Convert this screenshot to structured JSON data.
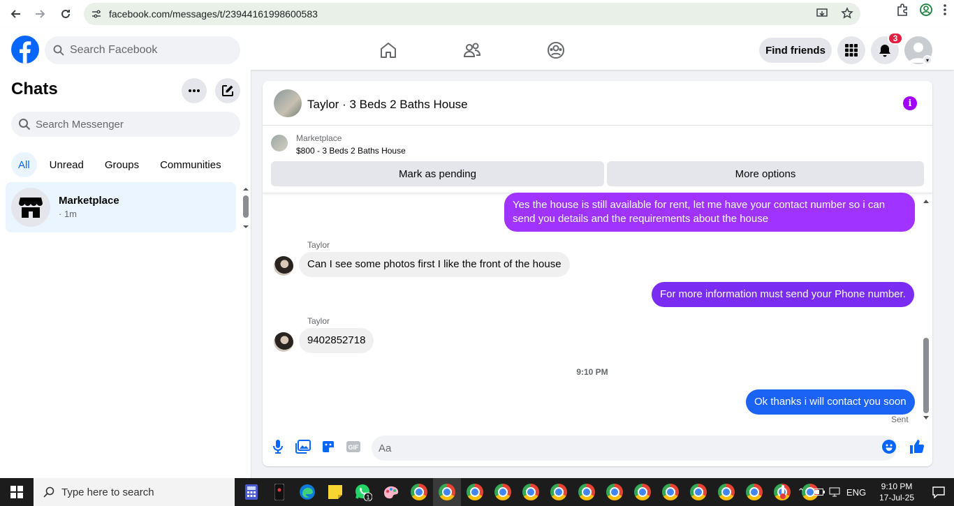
{
  "browser": {
    "url": "facebook.com/messages/t/23944161998600583"
  },
  "header": {
    "search_placeholder": "Search Facebook",
    "find_friends_label": "Find friends",
    "notification_count": "3"
  },
  "sidebar": {
    "title": "Chats",
    "search_placeholder": "Search Messenger",
    "tabs": [
      {
        "label": "All",
        "active": true
      },
      {
        "label": "Unread",
        "active": false
      },
      {
        "label": "Groups",
        "active": false
      },
      {
        "label": "Communities",
        "active": false
      }
    ],
    "chats": [
      {
        "name": "Marketplace",
        "time": "· 1m"
      }
    ]
  },
  "conversation": {
    "title": "Taylor · 3 Beds 2 Baths House",
    "marketplace": {
      "source": "Marketplace",
      "listing": "$800 - 3 Beds 2 Baths House",
      "pending_label": "Mark as pending",
      "options_label": "More options"
    },
    "messages": [
      {
        "direction": "out",
        "text": "Yes the house is still available for rent, let me have your contact number so i can send you details and the requirements about the house"
      },
      {
        "direction": "in",
        "sender": "Taylor",
        "text": "Can I see some photos first I like the front of the house"
      },
      {
        "direction": "out",
        "text": "For more information must send your Phone number."
      },
      {
        "direction": "in",
        "sender": "Taylor",
        "text": "9402852718"
      },
      {
        "direction": "out",
        "text": "Ok thanks i will contact you soon"
      }
    ],
    "timestamp": "9:10 PM",
    "sent_label": "Sent",
    "composer_placeholder": "Aa"
  },
  "colors": {
    "brand_blue": "#0866ff",
    "bubble_purple": "#a033ff",
    "bubble_violet": "#7a2cf2",
    "bubble_blue": "#1a63f5",
    "info_purple": "#a200ff"
  },
  "taskbar": {
    "search_placeholder": "Type here to search",
    "time": "9:10 PM",
    "date": "17-Jul-25",
    "language": "ENG",
    "whatsapp_badge": "1"
  }
}
